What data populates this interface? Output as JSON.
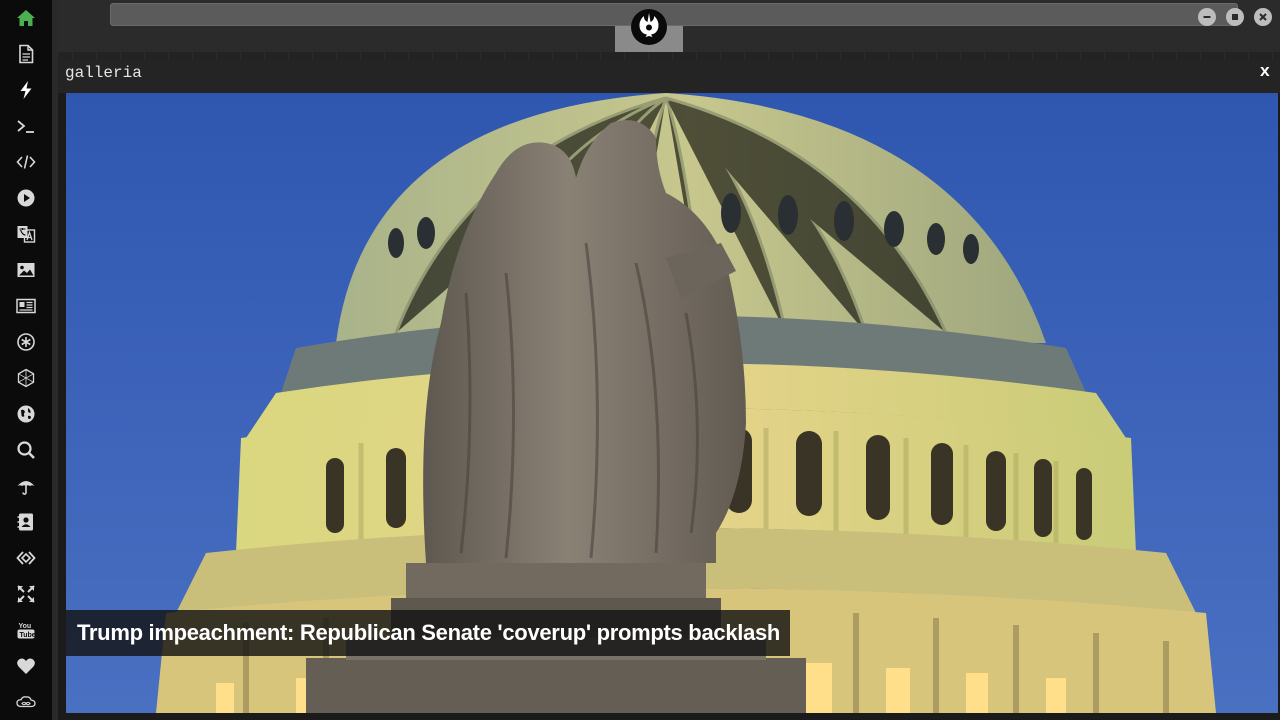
{
  "window": {
    "address_value": "",
    "controls": {
      "minimize_icon": "minus-circle-icon",
      "maximize_icon": "stop-circle-icon",
      "close_icon": "close-circle-icon"
    },
    "logo_icon": "rebel-alliance-icon"
  },
  "sidebar": {
    "accent": "#4caf50",
    "items": [
      {
        "icon": "home-icon",
        "active": true
      },
      {
        "icon": "document-icon"
      },
      {
        "icon": "lightning-icon"
      },
      {
        "icon": "terminal-icon"
      },
      {
        "icon": "code-icon"
      },
      {
        "icon": "play-circle-icon"
      },
      {
        "icon": "translate-icon"
      },
      {
        "icon": "image-icon"
      },
      {
        "icon": "newspaper-icon"
      },
      {
        "icon": "asterisk-circle-icon"
      },
      {
        "icon": "hexagon-network-icon"
      },
      {
        "icon": "globe-icon"
      },
      {
        "icon": "search-icon"
      },
      {
        "icon": "umbrella-icon"
      },
      {
        "icon": "contact-card-icon"
      },
      {
        "icon": "embed-icon"
      },
      {
        "icon": "expand-icon"
      },
      {
        "icon": "youtube-icon"
      },
      {
        "icon": "heart-icon"
      },
      {
        "icon": "infinity-cloud-icon"
      }
    ]
  },
  "panel": {
    "title": "galleria",
    "close_label": "x",
    "caption": "Trump impeachment: Republican Senate 'coverup' prompts backlash"
  }
}
